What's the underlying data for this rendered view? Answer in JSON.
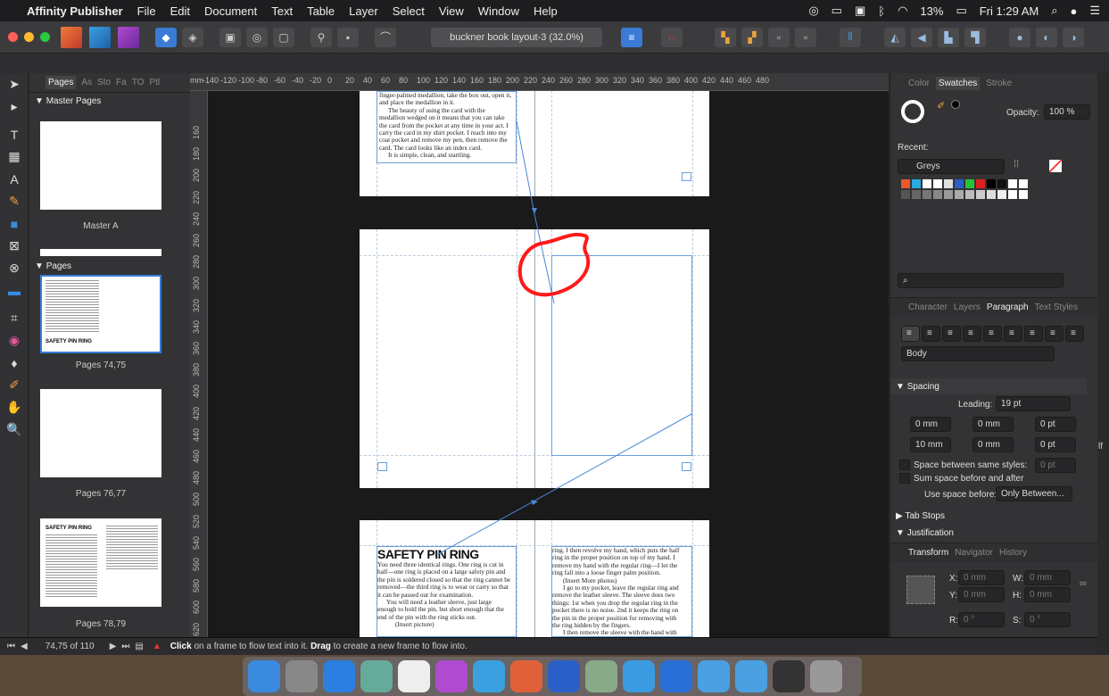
{
  "menubar": {
    "app_name": "Affinity Publisher",
    "items": [
      "File",
      "Edit",
      "Document",
      "Text",
      "Table",
      "Layer",
      "Select",
      "View",
      "Window",
      "Help"
    ],
    "battery": "13%",
    "clock": "Fri 1:29 AM"
  },
  "toolbar": {
    "document_title": "buckner book layout-3 (32.0%)"
  },
  "pages_panel": {
    "tabs": [
      "Pages",
      "As",
      "Sto",
      "Fa",
      "TO",
      "Ptl"
    ],
    "master_section": "Master Pages",
    "master_label": "Master A",
    "pages_section": "Pages",
    "spreads": [
      {
        "label": "Pages 74,75",
        "heading": "SAFETY PIN RING"
      },
      {
        "label": "Pages 76,77",
        "heading": ""
      },
      {
        "label": "Pages 78,79",
        "heading": "SAFETY PIN RING"
      }
    ]
  },
  "ruler": {
    "units": "mm",
    "h_ticks": [
      "-140",
      "-120",
      "-100",
      "-80",
      "-60",
      "-40",
      "-20",
      "0",
      "20",
      "40",
      "60",
      "80",
      "100",
      "120",
      "140",
      "160",
      "180",
      "200",
      "220",
      "240",
      "260",
      "280",
      "300",
      "320",
      "340",
      "360",
      "380",
      "400",
      "420",
      "440",
      "460",
      "480"
    ],
    "v_ticks": [
      "160",
      "180",
      "200",
      "220",
      "240",
      "260",
      "280",
      "300",
      "320",
      "340",
      "360",
      "380",
      "400",
      "420",
      "440",
      "460",
      "480",
      "500",
      "520",
      "540",
      "560",
      "580",
      "600",
      "620",
      "640"
    ]
  },
  "canvas": {
    "top_page_text": [
      "finger-palmed medallion, take the box out, open it,",
      "and place the medallion in it.",
      "The beauty of using the card with the",
      "medallion wedged on it means that you can take",
      "the card from the pocket at any time in your act. I",
      "carry the card in my shirt pocket. I reach into my",
      "coat pocket and remove my pen, then remove the",
      "card. The card looks like an index card.",
      "It is simple, clean, and startling."
    ],
    "safety_heading": "SAFETY PIN RING",
    "left_col_text": [
      "You need three identical rings. One ring is cut in",
      "half—one ring is placed on a large safety pin and",
      "the pin is soldered closed so that the ring cannot be",
      "removed—the third ring is to wear or carry so that",
      "it can be passed out for examination.",
      "You will need a leather sleeve, just large",
      "enough to hold the pin, but short enough that the",
      "end of the pin with the ring sticks out.",
      "(Insert picture)"
    ],
    "right_col_text": [
      "ring. I then revolve my hand, which puts the half",
      "ring in the proper position on top of my hand. I",
      "remove my hand with the regular ring—I let the",
      "ring fall into a loose finger palm position.",
      "(Insert More photos)",
      "I go to my pocket, leave the regular ring and",
      "remove the leather sleeve. The sleeve does two",
      "things: 1st when you drop the regular ring in the",
      "pocket there is no noise. 2nd it keeps the ring on",
      "the pin in the proper position for removing with",
      "the ring hidden by the fingers.",
      "I then remove the sleeve with the hand with"
    ]
  },
  "right_panel": {
    "top_tabs": [
      "Color",
      "Swatches",
      "Stroke"
    ],
    "active_top_tab": "Swatches",
    "opacity_label": "Opacity:",
    "opacity_value": "100 %",
    "recent_label": "Recent:",
    "palette_name": "Greys",
    "swatch_colors": [
      "#e85a2a",
      "#29a9e0",
      "#ffffff",
      "#ffffff",
      "#e0e0e0",
      "#2a5fc8",
      "#27c23a",
      "#e02020",
      "#000000",
      "#111111",
      "#ffffff",
      "#ffffff"
    ],
    "grey_swatches": [
      "#555",
      "#666",
      "#777",
      "#888",
      "#999",
      "#aaa",
      "#bbb",
      "#ccc",
      "#ddd",
      "#eee",
      "#fff",
      "#fafafa"
    ],
    "mid_tabs": [
      "Character",
      "Layers",
      "Paragraph",
      "Text Styles"
    ],
    "active_mid_tab": "Paragraph",
    "style_value": "Body",
    "spacing_section": "Spacing",
    "leading_label": "Leading:",
    "leading_value": "19 pt",
    "indent_left": "0 mm",
    "indent_first": "0 mm",
    "space_before_pt": "0 pt",
    "indent_row2_left": "10 mm",
    "indent_row2_right": "0 mm",
    "space_after_pt": "0 pt",
    "same_styles_label": "Space between same styles:",
    "same_styles_value": "0 pt",
    "sum_space_label": "Sum space before and after",
    "use_space_label": "Use space before:",
    "use_space_value": "Only Between...",
    "tab_stops": "Tab Stops",
    "justification": "Justification",
    "bottom_tabs": [
      "Transform",
      "Navigator",
      "History"
    ],
    "active_bottom_tab": "Transform",
    "x_label": "X:",
    "x_value": "0 mm",
    "w_label": "W:",
    "w_value": "0 mm",
    "y_label": "Y:",
    "y_value": "0 mm",
    "h_label": "H:",
    "h_value": "0 mm",
    "r_label": "R:",
    "r_value": "0 °",
    "s_label": "S:",
    "s_value": "0 °",
    "edge_text": "lf"
  },
  "statusbar": {
    "page_info": "74,75 of 110",
    "hint_click": "Click",
    "hint_mid": " on a frame to flow text into it. ",
    "hint_drag": "Drag",
    "hint_end": " to create a new frame to flow into."
  },
  "colors": {
    "annotation_red": "#ff1a1a",
    "guide_blue": "#6a9fdc",
    "accent_blue": "#3a7bd5"
  },
  "dock_icons": [
    "finder-icon",
    "launchpad-icon",
    "safari-icon",
    "preview-icon",
    "textedit-icon",
    "affinity-publisher-icon",
    "affinity-designer-icon",
    "affinity-photo-icon",
    "word-icon",
    "photos-icon",
    "messages-icon",
    "browser-icon",
    "folder-icon",
    "folder-icon",
    "activity-icon",
    "trash-icon"
  ]
}
